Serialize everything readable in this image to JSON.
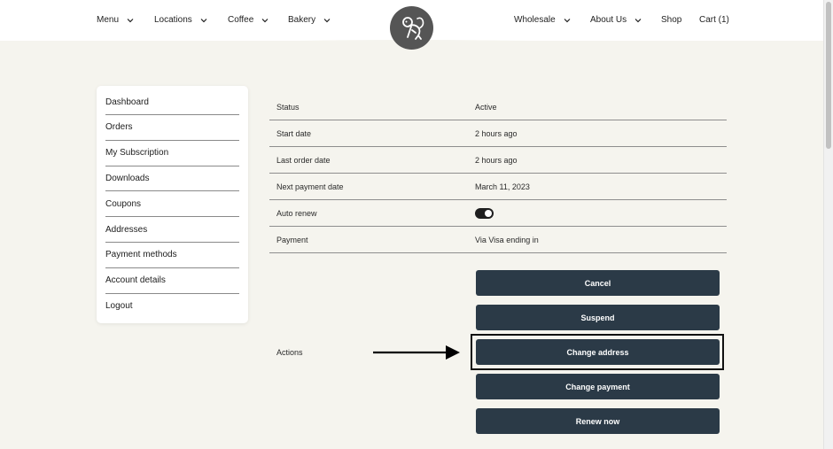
{
  "nav": {
    "left": [
      {
        "label": "Menu",
        "has_dropdown": true
      },
      {
        "label": "Locations",
        "has_dropdown": true
      },
      {
        "label": "Coffee",
        "has_dropdown": true
      },
      {
        "label": "Bakery",
        "has_dropdown": true
      }
    ],
    "right": [
      {
        "label": "Wholesale",
        "has_dropdown": true
      },
      {
        "label": "About Us",
        "has_dropdown": true
      },
      {
        "label": "Shop",
        "has_dropdown": false
      },
      {
        "label": "Cart (1)",
        "has_dropdown": false
      }
    ],
    "logo_icon": "monkey-logo-icon"
  },
  "sidebar": {
    "items": [
      "Dashboard",
      "Orders",
      "My Subscription",
      "Downloads",
      "Coupons",
      "Addresses",
      "Payment methods",
      "Account details",
      "Logout"
    ]
  },
  "subscription": {
    "rows": [
      {
        "label": "Status",
        "value": "Active"
      },
      {
        "label": "Start date",
        "value": "2 hours ago"
      },
      {
        "label": "Last order date",
        "value": "2 hours ago"
      },
      {
        "label": "Next payment date",
        "value": "March 11, 2023"
      },
      {
        "label": "Auto renew",
        "value": null,
        "toggle_on": true
      },
      {
        "label": "Payment",
        "value": "Via Visa ending in"
      }
    ],
    "actions_label": "Actions",
    "buttons": [
      "Cancel",
      "Suspend",
      "Change address",
      "Change payment",
      "Renew now"
    ],
    "highlighted_button": "Change address"
  },
  "colors": {
    "page_bg": "#f5f4ee",
    "button_bg": "#2b3a47",
    "logo_bg": "#555555"
  }
}
